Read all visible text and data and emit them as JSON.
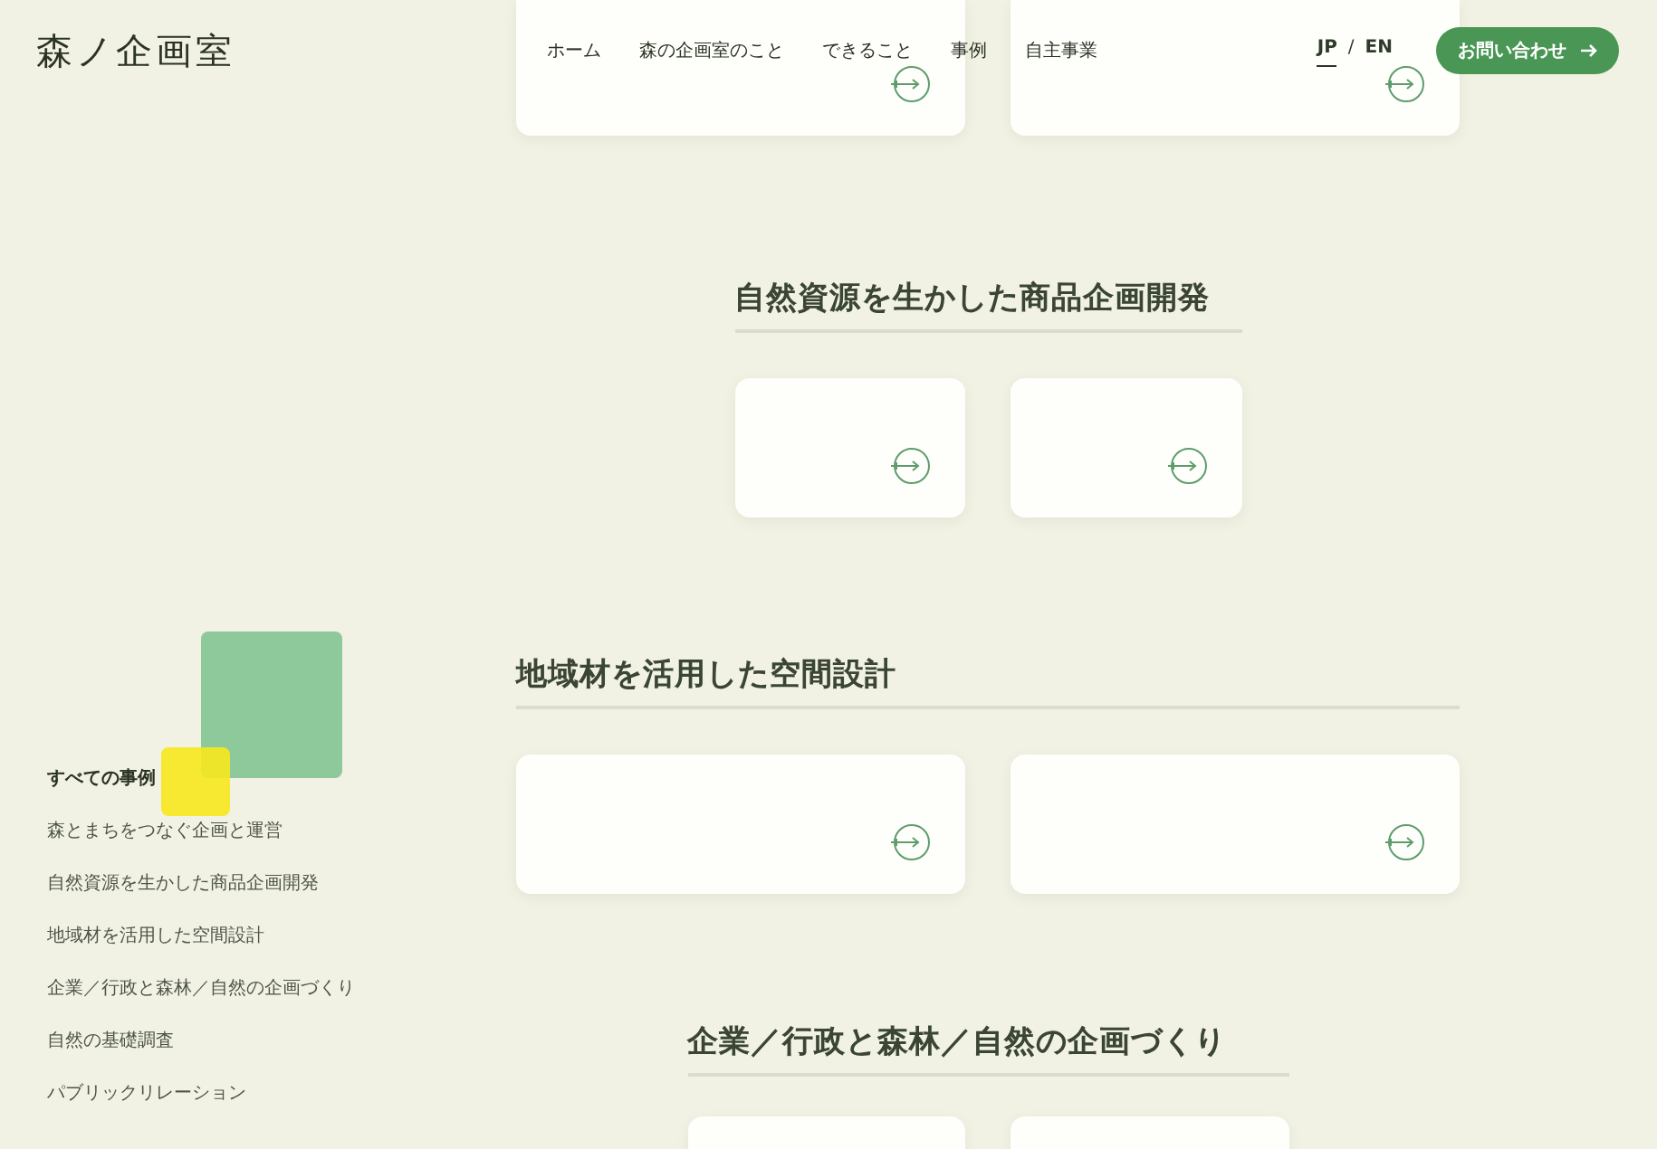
{
  "header": {
    "logo": "森ノ企画室",
    "nav": [
      "ホーム",
      "森の企画室のこと",
      "できること",
      "事例",
      "自主事業"
    ],
    "languages": [
      {
        "label": "JP",
        "selected": true
      },
      {
        "label": "EN",
        "selected": false
      }
    ],
    "language_separator": "/",
    "contact_button": "お問い合わせ"
  },
  "sidebar": {
    "categories": [
      {
        "label": "すべての事例",
        "selected": true
      },
      {
        "label": "森とまちをつなぐ企画と運営",
        "selected": false
      },
      {
        "label": "自然資源を生かした商品企画開発",
        "selected": false
      },
      {
        "label": "地域材を活用した空間設計",
        "selected": false
      },
      {
        "label": "企業／行政と森林／自然の企画づくり",
        "selected": false
      },
      {
        "label": "自然の基礎調査",
        "selected": false
      },
      {
        "label": "パブリックリレーション",
        "selected": false
      }
    ]
  },
  "sections": [
    {
      "cards": [
        {
          "arrow": true
        },
        {
          "arrow": true
        }
      ]
    },
    {
      "heading": "自然資源を生かした商品企画開発",
      "cards": [
        {
          "arrow": true
        },
        {
          "arrow": true
        }
      ]
    },
    {
      "heading": "地域材を活用した空間設計",
      "cards": [
        {
          "arrow": true
        },
        {
          "arrow": true
        }
      ]
    },
    {
      "heading": "企業／行政と森林／自然の企画づくり",
      "cards": [
        {
          "arrow": false
        },
        {
          "arrow": false
        }
      ]
    }
  ]
}
